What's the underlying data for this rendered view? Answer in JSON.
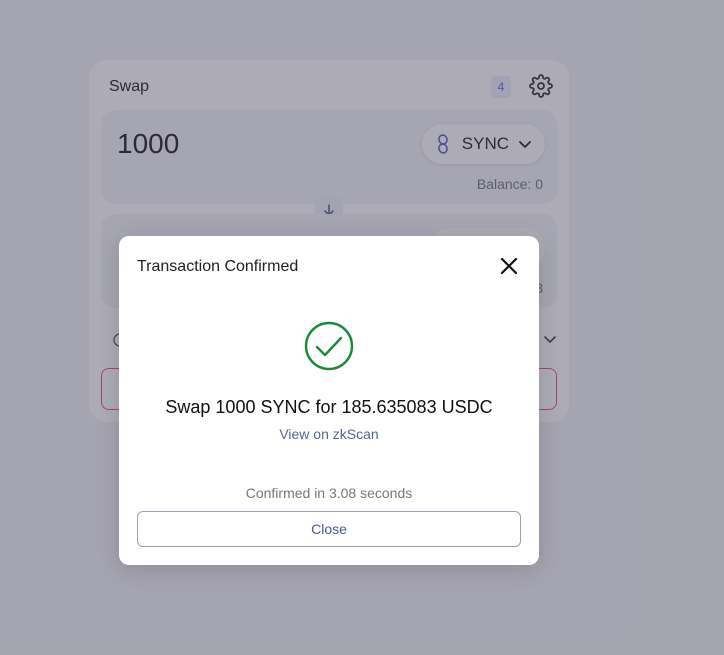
{
  "swap": {
    "title": "Swap",
    "tx_count": "4",
    "from": {
      "amount": "1000",
      "token": "SYNC",
      "balance": "Balance: 0"
    },
    "to": {
      "tail_text": "3"
    }
  },
  "modal": {
    "title": "Transaction Confirmed",
    "summary": "Swap 1000 SYNC for 185.635083 USDC",
    "explorer_link": "View on zkScan",
    "confirmed_time": "Confirmed in 3.08 seconds",
    "close_label": "Close"
  },
  "colors": {
    "success": "#1a8a3a",
    "accent_text": "#5a6493",
    "swap_button_border": "#e65b6a",
    "badge_bg": "#eceefe",
    "badge_text": "#6b70d8"
  },
  "icons": {
    "settings": "gear-icon",
    "token": "sync-token-icon",
    "chevron": "chevron-down-icon",
    "switch": "arrow-down-icon",
    "close": "close-icon",
    "success": "check-circle-icon"
  }
}
